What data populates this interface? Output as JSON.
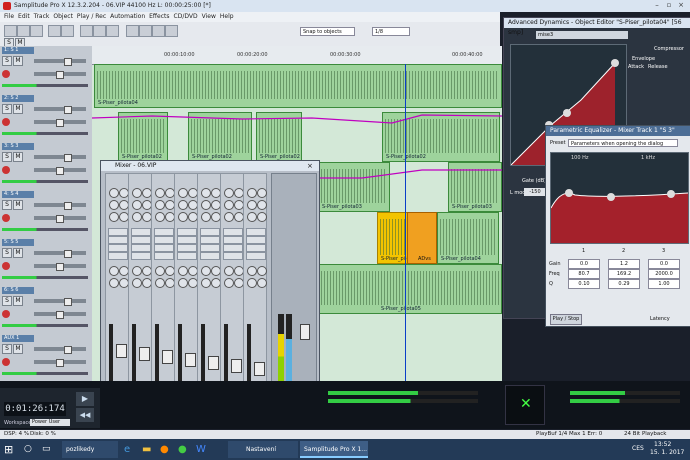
{
  "app": {
    "title": "Samplitude Pro X 12.3.2.204 - 06.VIP  44100 Hz L: 00:00:25:00 [*]"
  },
  "menu": [
    "File",
    "Edit",
    "Track",
    "Object",
    "Play / Rec",
    "Automation",
    "Effects",
    "CD/DVD",
    "View",
    "Help"
  ],
  "toolbar": {
    "snap_label": "Snap to objects",
    "grid_value": "1/8"
  },
  "ruler": {
    "marks": [
      "00:00:10:00",
      "00:00:20:00",
      "00:00:30:00",
      "00:00:40:00"
    ]
  },
  "tracks": [
    {
      "label": "1: S 1",
      "id": "t1"
    },
    {
      "label": "2: S 2",
      "id": "t2"
    },
    {
      "label": "3: S 3",
      "id": "t3"
    },
    {
      "label": "4: S 4",
      "id": "t4"
    },
    {
      "label": "5: S 5",
      "id": "t5"
    },
    {
      "label": "6: S 6",
      "id": "t6"
    },
    {
      "label": "AUX 1",
      "id": "aux1"
    }
  ],
  "clips": {
    "c1": "S-Piser_pilota04",
    "c2": "S-Piser_pilota02",
    "c3": "S-Piser_pilota02",
    "c4": "S-Piser_pilota02",
    "c5": "S-Piser_pilota02",
    "c6": "S-Piser_pilota03",
    "c7": "S-Piser_pilota03",
    "c8": "S-Piser_pilota04",
    "c9": "S-Piser_pilota04",
    "c10": "ADvs",
    "c11": "S-Piser_pilota04",
    "c12": "S-Piser_pilota05",
    "c13": "S-Piser_pilota05",
    "c14": "S-Piser_pilota05"
  },
  "mixer": {
    "title": "Mixer - 06.VIP",
    "strips": [
      "1",
      "2",
      "3",
      "4",
      "5",
      "6",
      "AUX 1"
    ],
    "master_label": "master"
  },
  "dynamics": {
    "title": "Advanced Dynamics - Object Editor \"S-Piser_pilota04\" [56 smp]",
    "preset": "mise3",
    "labels": [
      "Compressor",
      "Envelope",
      "Attack",
      "Release",
      "Gate (dB)",
      "L mod"
    ],
    "gate_value": "-150",
    "lmod_value": "0.0"
  },
  "eq": {
    "title": "Parametric Equalizer - Mixer Track 1 \"S 3\"",
    "preset_label": "Preset",
    "preset_value": "Parameters when opening the dialog",
    "freq_labels": [
      "100 Hz",
      "1 kHz"
    ],
    "bands": [
      {
        "n": "1",
        "gain": "0.0",
        "freq": "80.7",
        "q": "0.10"
      },
      {
        "n": "2",
        "gain": "1.2",
        "freq": "169.2",
        "q": "0.29"
      },
      {
        "n": "3",
        "gain": "0.0",
        "freq": "2000.0",
        "q": "1.00"
      }
    ],
    "row_labels": [
      "Gain",
      "Freq",
      "Q"
    ],
    "play_stop": "Play / Stop",
    "latency_label": "Latency"
  },
  "transport": {
    "counter": "0:01:26:174",
    "workspace_label": "Workspace",
    "workspace_value": "Power User"
  },
  "status": {
    "dsp": "DSP: 4 %",
    "disk": "Disk: 0 %",
    "playbuf": "PlayBuf 1/4  Max 1  Err: 0",
    "bit": "24 Bit Playback"
  },
  "taskbar": {
    "items": [
      "pozlikedy",
      "Nastavení",
      "Samplitude Pro X 1..."
    ],
    "lang": "CES",
    "time": "13:52",
    "date": "15. 1. 2017"
  },
  "colors": {
    "clip_green": "#9ed39c",
    "clip_select": "#f3c400",
    "automation": "#c000c0",
    "eq_curve": "#c0222a"
  }
}
